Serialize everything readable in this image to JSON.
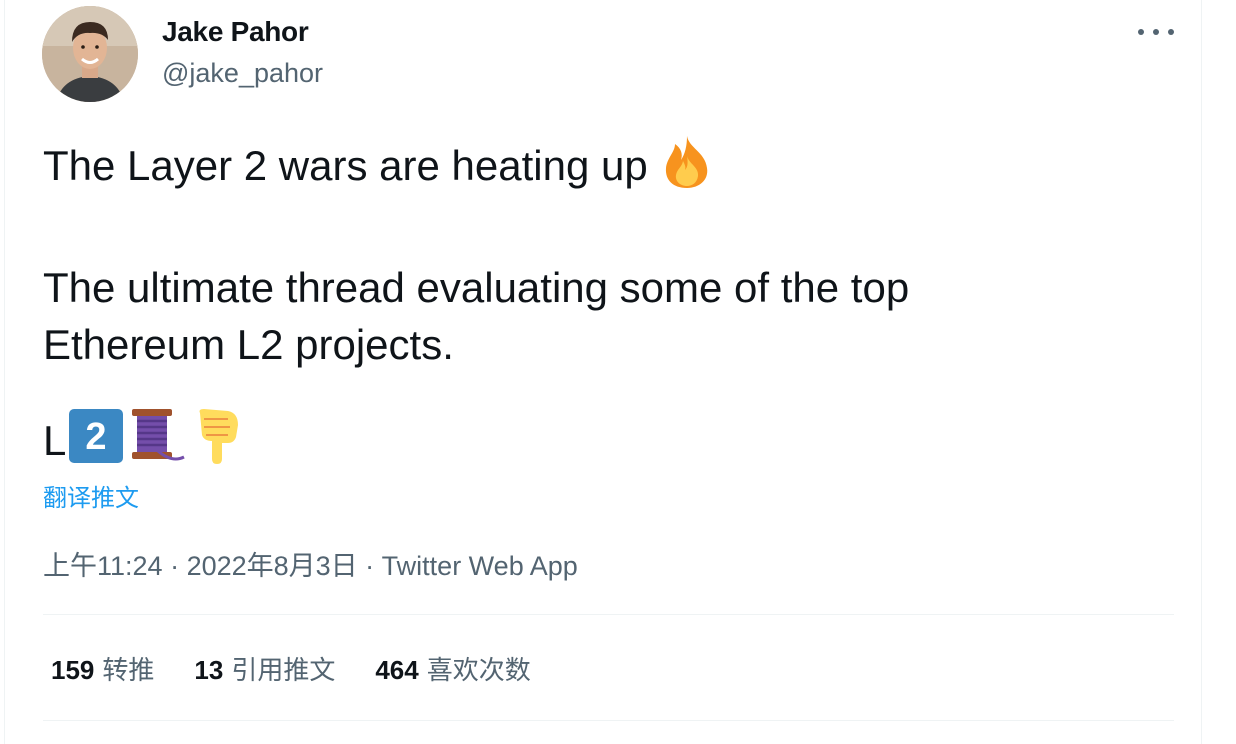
{
  "author": {
    "name": "Jake Pahor",
    "handle": "@jake_pahor"
  },
  "tweet": {
    "line1": "The Layer 2 wars are heating up",
    "line1_emoji": "fire-icon",
    "line2": "The ultimate thread evaluating some of the top",
    "line2b": "Ethereum L2 projects.",
    "line3_text": "L",
    "line3_keycap": "2",
    "line3_emojis": [
      "keycap-2-icon",
      "thread-spool-icon",
      "pointing-down-icon"
    ]
  },
  "translate_label": "翻译推文",
  "meta": {
    "time": "上午11:24",
    "sep1": " · ",
    "date": "2022年8月3日",
    "sep2": " · ",
    "source": "Twitter Web App"
  },
  "stats": [
    {
      "count": "159",
      "label": "转推"
    },
    {
      "count": "13",
      "label": "引用推文"
    },
    {
      "count": "464",
      "label": "喜欢次数"
    }
  ],
  "colors": {
    "text": "#0f1419",
    "secondary": "#536471",
    "link": "#1d9bf0",
    "divider": "#eff3f4"
  }
}
